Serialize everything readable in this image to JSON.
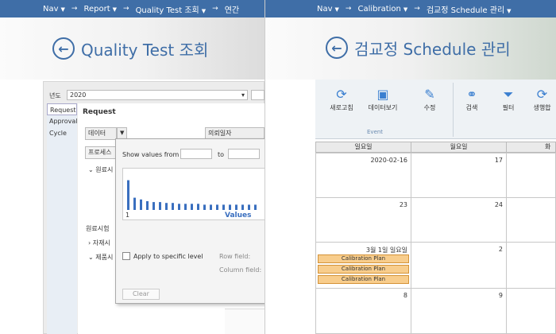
{
  "left": {
    "nav": {
      "items": [
        "Nav",
        "Report",
        "Quality Test 조회",
        "연간"
      ]
    },
    "title": "Quality Test 조회",
    "year_label": "년도",
    "year_value": "2020",
    "sidebar": [
      "Request",
      "Approval",
      "Cycle"
    ],
    "section_title": "Request",
    "grid_header": {
      "col1": "데이터",
      "col2": "의뢰일자"
    },
    "rows": [
      "프로세스",
      "원료시",
      "원료시험",
      "자재시",
      "제품시"
    ],
    "filter": {
      "show_values_from": "Show values from",
      "to": "to",
      "axis_start": "1",
      "axis_label": "Values",
      "apply_specific": "Apply to specific level",
      "row_field": "Row field:",
      "column_field": "Column field:",
      "clear": "Clear"
    }
  },
  "right": {
    "nav": {
      "items": [
        "Nav",
        "Calibration",
        "검교정 Schedule 관리"
      ]
    },
    "title": "검교정 Schedule 관리",
    "toolbar": {
      "refresh": "새로고침",
      "view_data": "데이터보기",
      "edit": "수정",
      "group_label": "Event",
      "search": "검색",
      "filter": "필터",
      "generate": "생행합"
    },
    "day_headers": [
      "일요일",
      "월요일",
      "화요"
    ],
    "weeks": [
      {
        "sun": "2020-02-16",
        "mon": "17"
      },
      {
        "sun": "23",
        "mon": "24"
      },
      {
        "sun": "3월 1일 일요일",
        "mon": "2"
      },
      {
        "sun": "8",
        "mon": "9"
      }
    ],
    "events": [
      "Calibration Plan",
      "Calibration Plan",
      "Calibration Plan"
    ]
  },
  "chart_data": {
    "type": "bar",
    "values": [
      34,
      14,
      12,
      10,
      9,
      9,
      8,
      8,
      7,
      7,
      7,
      7,
      6,
      6,
      6,
      6,
      6,
      6,
      6,
      6,
      6
    ],
    "xlabel": "Values"
  }
}
